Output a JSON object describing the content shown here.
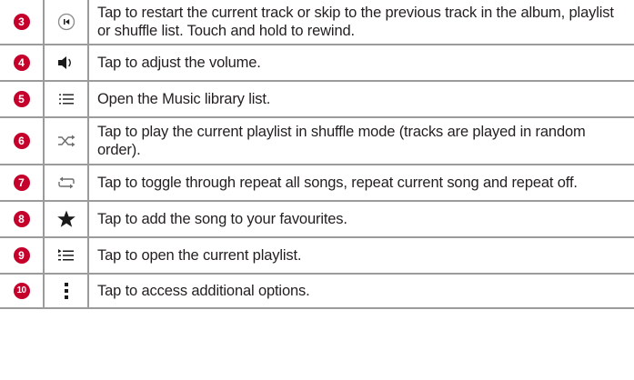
{
  "rows": [
    {
      "number": "3",
      "icon": "previous-track-icon",
      "text": "Tap to restart the current track or skip to the previous track in the album, playlist or shuffle list. Touch and hold to rewind."
    },
    {
      "number": "4",
      "icon": "volume-icon",
      "text": "Tap to adjust the volume."
    },
    {
      "number": "5",
      "icon": "music-library-icon",
      "text": "Open the Music library list."
    },
    {
      "number": "6",
      "icon": "shuffle-icon",
      "text": "Tap to play the current playlist in shuffle mode (tracks are played in random order)."
    },
    {
      "number": "7",
      "icon": "repeat-icon",
      "text": "Tap to toggle through repeat all songs, repeat current song and repeat off."
    },
    {
      "number": "8",
      "icon": "star-icon",
      "text": "Tap to add the song to your favourites."
    },
    {
      "number": "9",
      "icon": "playlist-icon",
      "text": "Tap to open the current playlist."
    },
    {
      "number": "10",
      "icon": "more-options-icon",
      "text": "Tap to access additional options."
    }
  ],
  "colors": {
    "number_badge": "#c4002b",
    "border": "#9b9b9b",
    "icon": "#1a1a1a",
    "text": "#231f20"
  }
}
